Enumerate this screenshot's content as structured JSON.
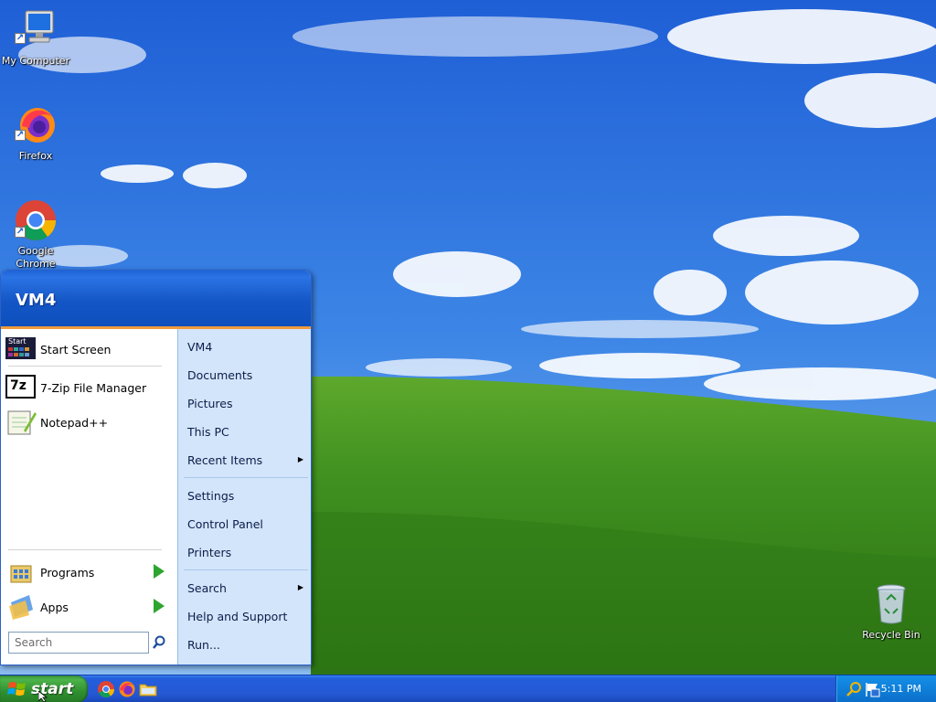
{
  "desktop": {
    "icons": [
      {
        "label": "My Computer",
        "icon": "my-computer-icon"
      },
      {
        "label": "Firefox",
        "icon": "firefox-icon"
      },
      {
        "label": "Google Chrome",
        "icon": "chrome-icon"
      },
      {
        "label": "Recycle Bin",
        "icon": "recycle-bin-icon"
      }
    ]
  },
  "start_menu": {
    "user_name": "VM4",
    "pinned": [
      {
        "label": "Start Screen",
        "icon": "start-screen-icon",
        "badge": "Start"
      },
      {
        "label": "7-Zip File Manager",
        "icon": "7zip-icon",
        "badge": "7z"
      },
      {
        "label": "Notepad++",
        "icon": "notepadpp-icon"
      }
    ],
    "bottom_left": [
      {
        "label": "Programs",
        "icon": "programs-icon"
      },
      {
        "label": "Apps",
        "icon": "apps-icon"
      }
    ],
    "search": {
      "placeholder": "Search"
    },
    "right": [
      {
        "label": "VM4"
      },
      {
        "label": "Documents"
      },
      {
        "label": "Pictures"
      },
      {
        "label": "This PC"
      },
      {
        "label": "Recent Items",
        "submenu": true
      },
      {
        "label": "Settings"
      },
      {
        "label": "Control Panel"
      },
      {
        "label": "Printers"
      },
      {
        "label": "Search",
        "submenu": true
      },
      {
        "label": "Help and Support"
      },
      {
        "label": "Run..."
      }
    ]
  },
  "taskbar": {
    "start_label": "start",
    "quick_launch": [
      "chrome-icon",
      "firefox-icon",
      "file-explorer-icon"
    ],
    "tray_icons": [
      "search-icon",
      "action-center-flag-icon"
    ],
    "clock": "5:11 PM"
  },
  "colors": {
    "taskbar_blue": "#245edc",
    "start_green": "#2f8f2f",
    "start_menu_header": "#1456c6",
    "start_menu_right": "#d3e5fa",
    "accent_orange": "#f09b3b"
  }
}
